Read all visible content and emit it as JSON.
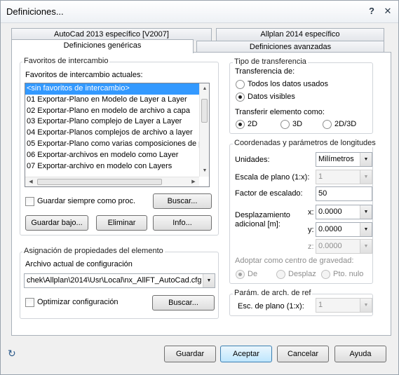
{
  "window": {
    "title": "Definiciones...",
    "help": "?",
    "close": "✕"
  },
  "tabs": {
    "top": [
      "AutoCad 2013 específico [V2007]",
      "Allplan 2014 específico"
    ],
    "bottom": [
      "Definiciones genéricas",
      "Definiciones avanzadas"
    ]
  },
  "favoritos": {
    "group_title": "Favoritos de intercambio",
    "label": "Favoritos de intercambio actuales:",
    "items": [
      "<sin favoritos de intercambio>",
      "01 Exportar-Plano en Modelo de Layer a Layer",
      "02 Exportar-Plano en modelo de archivo a capa",
      "03 Exportar-Plano complejo de Layer a Layer",
      "04 Exportar-Planos complejos de archivo a layer",
      "05 Exportar-Plano como varias composiciones de pla",
      "06 Exportar-archivos en modelo como Layer",
      "07 Exportar-archivo en modelo con Layers"
    ],
    "selected_index": 0,
    "guardar_siempre": "Guardar siempre como proc.",
    "buscar": "Buscar...",
    "guardar_bajo": "Guardar bajo...",
    "eliminar": "Eliminar",
    "info": "Info..."
  },
  "asignacion": {
    "group_title": "Asignación de propiedades del elemento",
    "label": "Archivo actual de configuración",
    "file": "chek\\Allplan\\2014\\Usr\\Local\\nx_AllFT_AutoCad.cfg",
    "optimizar": "Optimizar configuración",
    "buscar": "Buscar..."
  },
  "transferencia": {
    "group_title": "Tipo de transferencia",
    "label": "Transferencia de:",
    "options": [
      "Todos los datos usados",
      "Datos visibles"
    ],
    "selected": 1,
    "elem_label": "Transferir elemento como:",
    "elem_options": [
      "2D",
      "3D",
      "2D/3D"
    ],
    "elem_selected": 0
  },
  "coordenadas": {
    "group_title": "Coordenadas y parámetros de longitudes",
    "unidades_label": "Unidades:",
    "unidades_value": "Milímetros",
    "escala_label": "Escala de plano (1:x):",
    "escala_value": "1",
    "factor_label": "Factor de escalado:",
    "factor_value": "50",
    "desplaz_label_1": "Desplazamiento",
    "desplaz_label_2": "adicional [m]:",
    "x_label": "x:",
    "x_value": "0.0000",
    "y_label": "y:",
    "y_value": "0.0000",
    "z_label": "z:",
    "z_value": "0.0000",
    "centro_label": "Adoptar como centro de gravedad:",
    "centro_options": [
      "De",
      "Desplaz",
      "Pto. nulo"
    ],
    "centro_selected": 0
  },
  "ref": {
    "group_title": "Parám. de arch. de ref",
    "esc_label": "Esc. de plano (1:x):",
    "esc_value": "1"
  },
  "footer": {
    "guardar": "Guardar",
    "aceptar": "Aceptar",
    "cancelar": "Cancelar",
    "ayuda": "Ayuda"
  }
}
